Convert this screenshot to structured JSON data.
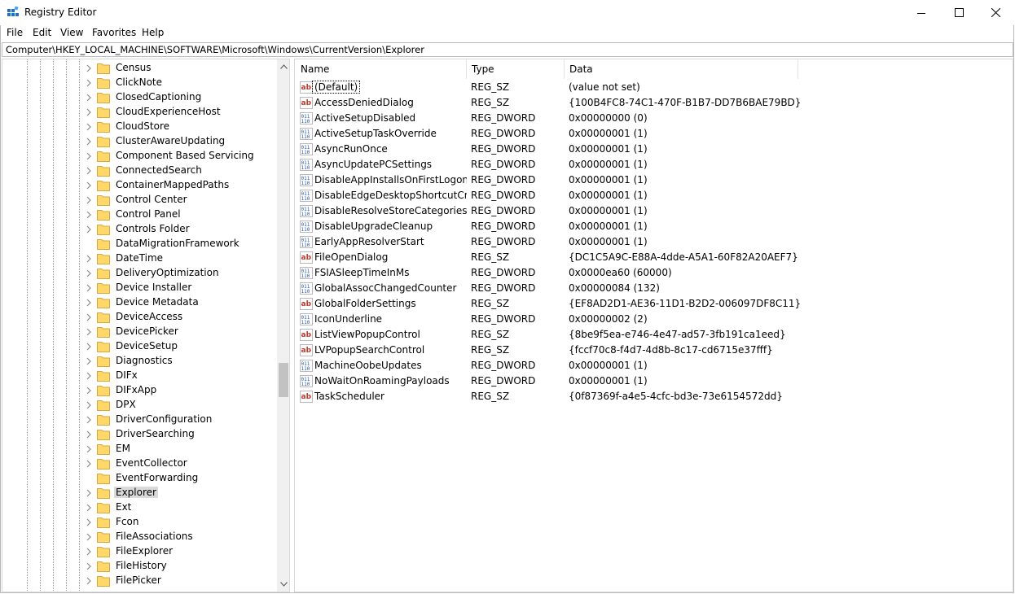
{
  "window": {
    "title": "Registry Editor",
    "controls": [
      "minimize-icon",
      "maximize-icon",
      "close-icon"
    ]
  },
  "menu": [
    "File",
    "Edit",
    "View",
    "Favorites",
    "Help"
  ],
  "address": "Computer\\HKEY_LOCAL_MACHINE\\SOFTWARE\\Microsoft\\Windows\\CurrentVersion\\Explorer",
  "tree": {
    "items": [
      {
        "label": "Census",
        "expandable": true
      },
      {
        "label": "ClickNote",
        "expandable": true
      },
      {
        "label": "ClosedCaptioning",
        "expandable": true
      },
      {
        "label": "CloudExperienceHost",
        "expandable": true
      },
      {
        "label": "CloudStore",
        "expandable": true
      },
      {
        "label": "ClusterAwareUpdating",
        "expandable": true
      },
      {
        "label": "Component Based Servicing",
        "expandable": true
      },
      {
        "label": "ConnectedSearch",
        "expandable": true
      },
      {
        "label": "ContainerMappedPaths",
        "expandable": true
      },
      {
        "label": "Control Center",
        "expandable": true
      },
      {
        "label": "Control Panel",
        "expandable": true
      },
      {
        "label": "Controls Folder",
        "expandable": true
      },
      {
        "label": "DataMigrationFramework",
        "expandable": false
      },
      {
        "label": "DateTime",
        "expandable": true
      },
      {
        "label": "DeliveryOptimization",
        "expandable": true
      },
      {
        "label": "Device Installer",
        "expandable": true
      },
      {
        "label": "Device Metadata",
        "expandable": true
      },
      {
        "label": "DeviceAccess",
        "expandable": true
      },
      {
        "label": "DevicePicker",
        "expandable": true
      },
      {
        "label": "DeviceSetup",
        "expandable": true
      },
      {
        "label": "Diagnostics",
        "expandable": true
      },
      {
        "label": "DIFx",
        "expandable": true
      },
      {
        "label": "DIFxApp",
        "expandable": true
      },
      {
        "label": "DPX",
        "expandable": true
      },
      {
        "label": "DriverConfiguration",
        "expandable": true
      },
      {
        "label": "DriverSearching",
        "expandable": true
      },
      {
        "label": "EM",
        "expandable": true
      },
      {
        "label": "EventCollector",
        "expandable": true
      },
      {
        "label": "EventForwarding",
        "expandable": false
      },
      {
        "label": "Explorer",
        "expandable": true,
        "selected": true
      },
      {
        "label": "Ext",
        "expandable": true
      },
      {
        "label": "Fcon",
        "expandable": true
      },
      {
        "label": "FileAssociations",
        "expandable": true
      },
      {
        "label": "FileExplorer",
        "expandable": true
      },
      {
        "label": "FileHistory",
        "expandable": true
      },
      {
        "label": "FilePicker",
        "expandable": true
      }
    ]
  },
  "list": {
    "columns": [
      "Name",
      "Type",
      "Data"
    ],
    "rows": [
      {
        "icon": "string-value-icon",
        "name": "(Default)",
        "type": "REG_SZ",
        "data": "(value not set)",
        "focus": true
      },
      {
        "icon": "string-value-icon",
        "name": "AccessDeniedDialog",
        "type": "REG_SZ",
        "data": "{100B4FC8-74C1-470F-B1B7-DD7B6BAE79BD}"
      },
      {
        "icon": "binary-value-icon",
        "name": "ActiveSetupDisabled",
        "type": "REG_DWORD",
        "data": "0x00000000 (0)"
      },
      {
        "icon": "binary-value-icon",
        "name": "ActiveSetupTaskOverride",
        "type": "REG_DWORD",
        "data": "0x00000001 (1)"
      },
      {
        "icon": "binary-value-icon",
        "name": "AsyncRunOnce",
        "type": "REG_DWORD",
        "data": "0x00000001 (1)"
      },
      {
        "icon": "binary-value-icon",
        "name": "AsyncUpdatePCSettings",
        "type": "REG_DWORD",
        "data": "0x00000001 (1)"
      },
      {
        "icon": "binary-value-icon",
        "name": "DisableAppInstallsOnFirstLogon",
        "type": "REG_DWORD",
        "data": "0x00000001 (1)"
      },
      {
        "icon": "binary-value-icon",
        "name": "DisableEdgeDesktopShortcutCrea...",
        "type": "REG_DWORD",
        "data": "0x00000001 (1)"
      },
      {
        "icon": "binary-value-icon",
        "name": "DisableResolveStoreCategories",
        "type": "REG_DWORD",
        "data": "0x00000001 (1)"
      },
      {
        "icon": "binary-value-icon",
        "name": "DisableUpgradeCleanup",
        "type": "REG_DWORD",
        "data": "0x00000001 (1)"
      },
      {
        "icon": "binary-value-icon",
        "name": "EarlyAppResolverStart",
        "type": "REG_DWORD",
        "data": "0x00000001 (1)"
      },
      {
        "icon": "string-value-icon",
        "name": "FileOpenDialog",
        "type": "REG_SZ",
        "data": "{DC1C5A9C-E88A-4dde-A5A1-60F82A20AEF7}"
      },
      {
        "icon": "binary-value-icon",
        "name": "FSIASleepTimeInMs",
        "type": "REG_DWORD",
        "data": "0x0000ea60 (60000)"
      },
      {
        "icon": "binary-value-icon",
        "name": "GlobalAssocChangedCounter",
        "type": "REG_DWORD",
        "data": "0x00000084 (132)"
      },
      {
        "icon": "string-value-icon",
        "name": "GlobalFolderSettings",
        "type": "REG_SZ",
        "data": "{EF8AD2D1-AE36-11D1-B2D2-006097DF8C11}"
      },
      {
        "icon": "binary-value-icon",
        "name": "IconUnderline",
        "type": "REG_DWORD",
        "data": "0x00000002 (2)"
      },
      {
        "icon": "string-value-icon",
        "name": "ListViewPopupControl",
        "type": "REG_SZ",
        "data": "{8be9f5ea-e746-4e47-ad57-3fb191ca1eed}"
      },
      {
        "icon": "string-value-icon",
        "name": "LVPopupSearchControl",
        "type": "REG_SZ",
        "data": "{fccf70c8-f4d7-4d8b-8c17-cd6715e37fff}"
      },
      {
        "icon": "binary-value-icon",
        "name": "MachineOobeUpdates",
        "type": "REG_DWORD",
        "data": "0x00000001 (1)"
      },
      {
        "icon": "binary-value-icon",
        "name": "NoWaitOnRoamingPayloads",
        "type": "REG_DWORD",
        "data": "0x00000001 (1)"
      },
      {
        "icon": "string-value-icon",
        "name": "TaskScheduler",
        "type": "REG_SZ",
        "data": "{0f87369f-a4e5-4cfc-bd3e-73e6154572dd}"
      }
    ]
  },
  "colors": {
    "folder": "#ffd867",
    "selection": "#d9d9d9",
    "string_icon": "#c0392b",
    "binary_icon": "#2b5aa8"
  }
}
